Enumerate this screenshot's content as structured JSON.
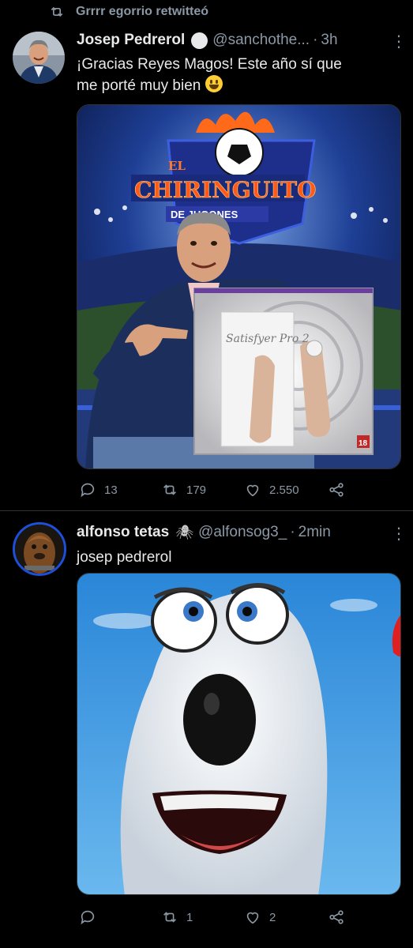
{
  "tweets": [
    {
      "social_context": "Grrrr egorrio retwitteó",
      "author_name": "Josep Pedrerol",
      "handle": "@sanchothe...",
      "separator": "·",
      "time": "3h",
      "more": "⋮",
      "text_line1": "¡Gracias Reyes Magos! Este año sí que",
      "text_line2": "me porté muy bien",
      "image_texts": {
        "show_title_top": "EL",
        "show_title": "CHIRINGUITO",
        "show_subtitle": "DE JUGONES",
        "product_brand": "Satisfyer Pro 2",
        "age_badge": "18"
      },
      "stats": {
        "replies": "13",
        "retweets": "179",
        "likes": "2.550"
      }
    },
    {
      "author_name": "alfonso tetas",
      "author_emoji": "🕷",
      "handle": "@alfonsog3_",
      "separator": "·",
      "time": "2min",
      "more": "⋮",
      "text": "josep pedrerol",
      "stats": {
        "replies": "",
        "retweets": "1",
        "likes": "2"
      }
    }
  ],
  "colors": {
    "background": "#000000",
    "text": "#e7e9ea",
    "muted": "#8b98a5",
    "divider": "#2f3336"
  },
  "icons": [
    "retweet-icon",
    "verified-badge-icon",
    "spider-icon",
    "reply-icon",
    "like-icon",
    "share-icon",
    "more-icon"
  ]
}
